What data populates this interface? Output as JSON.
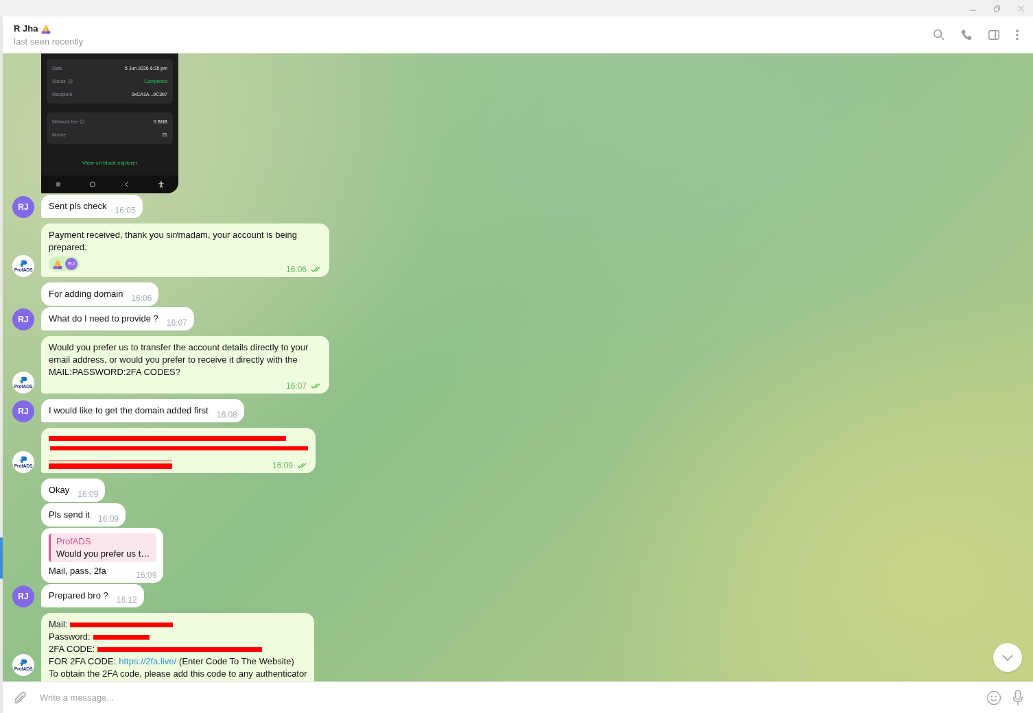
{
  "chat": {
    "title": "R Jha",
    "title_icon": {
      "kind": "praying-hands"
    },
    "status": "last seen recently"
  },
  "messages": [
    {
      "kind": "screenshot",
      "outgoing": false,
      "cards": [
        [
          {
            "label": "Date",
            "value": "5 Jun 2026 6:35 pm",
            "info": false,
            "highlight": false
          },
          {
            "label": "Status",
            "value": "Completed",
            "info": true,
            "highlight": true
          },
          {
            "label": "Recipient",
            "value": "0xCA1A...9C3b7",
            "info": false,
            "highlight": false
          }
        ],
        [
          {
            "label": "Network fee",
            "value": "0 BNB",
            "info": true,
            "highlight": false
          },
          {
            "label": "Nonce",
            "value": "21",
            "info": false,
            "highlight": false
          }
        ]
      ],
      "link": "View on block explorer"
    },
    {
      "kind": "text",
      "outgoing": false,
      "text": "Sent pls check",
      "time": "16:05",
      "avatar": {
        "kind": "initials",
        "text": "RJ"
      }
    },
    {
      "kind": "text",
      "outgoing": true,
      "text": "Payment received, thank you sir/madam, your account is being prepared.",
      "time": "16:06",
      "read": true,
      "avatar": {
        "kind": "logo",
        "text": "ProfADS"
      },
      "reactions": [
        {
          "kind": "praying-hands",
          "initials": "RJ"
        }
      ]
    },
    {
      "kind": "text",
      "outgoing": false,
      "text": "For adding domain",
      "time": "16:06"
    },
    {
      "kind": "text",
      "outgoing": false,
      "text": "What do I need to provide ?",
      "time": "16:07",
      "avatar": {
        "kind": "initials",
        "text": "RJ"
      }
    },
    {
      "kind": "text",
      "outgoing": true,
      "text": "Would you prefer us to transfer the account details directly to your email address, or would you prefer to receive it directly with the MAIL:PASSWORD:2FA CODES?",
      "time": "16:07",
      "read": true,
      "avatar": {
        "kind": "logo",
        "text": "ProfADS"
      }
    },
    {
      "kind": "text",
      "outgoing": false,
      "text": "I would like to get the domain added first",
      "time": "16:08",
      "avatar": {
        "kind": "initials",
        "text": "RJ"
      }
    },
    {
      "kind": "redacted",
      "outgoing": true,
      "time": "16:09",
      "read": true,
      "avatar": {
        "kind": "logo",
        "text": "ProfADS"
      }
    },
    {
      "kind": "text",
      "outgoing": false,
      "text": "Okay",
      "time": "16:09"
    },
    {
      "kind": "text",
      "outgoing": false,
      "text": "Pls send it",
      "time": "16:09"
    },
    {
      "kind": "reply",
      "outgoing": false,
      "reply_to": {
        "name": "ProfADS",
        "text": "Would you prefer us t…"
      },
      "text": "Mail, pass, 2fa",
      "time": "16:09"
    },
    {
      "kind": "text",
      "outgoing": false,
      "text": "Prepared bro ?",
      "time": "16:12",
      "avatar": {
        "kind": "initials",
        "text": "RJ"
      }
    },
    {
      "kind": "credentials",
      "outgoing": true,
      "avatar": {
        "kind": "logo",
        "text": "ProfADS"
      },
      "lines": [
        {
          "kind": "redacted",
          "label": "Mail:"
        },
        {
          "kind": "redacted",
          "label": "Password:"
        },
        {
          "kind": "redacted",
          "label": "2FA CODE:"
        },
        {
          "kind": "link",
          "label": "FOR 2FA CODE:",
          "link": "https://2fa.live/",
          "after": "(Enter Code To The Website)"
        },
        {
          "kind": "text",
          "text": "To obtain the 2FA code, please add this code to any authenticator"
        }
      ]
    }
  ],
  "composer": {
    "placeholder": "Write a message..."
  }
}
